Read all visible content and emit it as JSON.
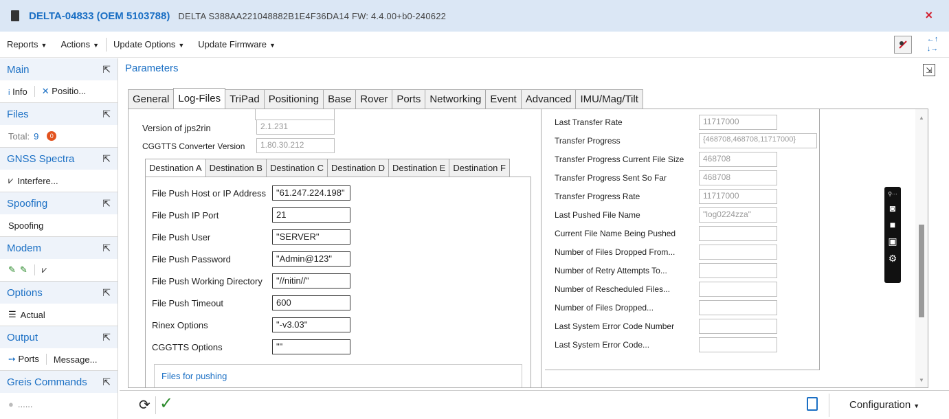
{
  "window": {
    "title": "DELTA-04833 (OEM 5103788)",
    "subtitle": "DELTA   S388AA221048882B1E4F36DA14   FW: 4.4.00+b0-240622",
    "close": "×"
  },
  "toolbar": {
    "reports": "Reports",
    "actions": "Actions",
    "update_options": "Update Options",
    "update_firmware": "Update Firmware",
    "caret": "▼"
  },
  "sidebar": {
    "main": {
      "label": "Main",
      "items": [
        "Info",
        "Positio..."
      ]
    },
    "files": {
      "label": "Files",
      "total_label": "Total:",
      "total": "9",
      "badge": "0"
    },
    "gnss": {
      "label": "GNSS Spectra",
      "item": "Interfere..."
    },
    "spoofing": {
      "label": "Spoofing",
      "item": "Spoofing"
    },
    "modem": {
      "label": "Modem"
    },
    "options": {
      "label": "Options",
      "item": "Actual"
    },
    "output": {
      "label": "Output",
      "items": [
        "Ports",
        "Message..."
      ]
    },
    "greis": {
      "label": "Greis Commands",
      "item": "......"
    }
  },
  "main": {
    "title": "Parameters",
    "tabs": [
      "General",
      "Log-Files",
      "TriPad",
      "Positioning",
      "Base",
      "Rover",
      "Ports",
      "Networking",
      "Event",
      "Advanced",
      "IMU/Mag/Tilt"
    ],
    "active_tab": "Log-Files"
  },
  "left": {
    "jps2rin_label": "Version of jps2rin",
    "jps2rin_value": "2.1.231",
    "cggtts_label": "CGGTTS Converter Version",
    "cggtts_value": "1.80.30.212",
    "dest_tabs": [
      "Destination A",
      "Destination B",
      "Destination C",
      "Destination D",
      "Destination E",
      "Destination F"
    ],
    "fields": [
      {
        "label": "File Push Host or IP Address",
        "value": "\"61.247.224.198\""
      },
      {
        "label": "File Push IP Port",
        "value": "21"
      },
      {
        "label": "File Push User",
        "value": "\"SERVER\""
      },
      {
        "label": "File Push Password",
        "value": "\"Admin@123\""
      },
      {
        "label": "File Push Working Directory",
        "value": "\"//nitin//\""
      },
      {
        "label": "File Push Timeout",
        "value": "600"
      },
      {
        "label": "Rinex Options",
        "value": "\"-v3.03\""
      },
      {
        "label": "CGGTTS Options",
        "value": "\"\""
      }
    ],
    "files_for_pushing": "Files for pushing"
  },
  "right": {
    "rows": [
      {
        "label": "Last Transfer Rate",
        "value": "11717000"
      },
      {
        "label": "Transfer Progress",
        "value": "{468708,468708,11717000}"
      },
      {
        "label": "Transfer Progress Current File Size",
        "value": "468708"
      },
      {
        "label": "Transfer Progress Sent So Far",
        "value": "468708"
      },
      {
        "label": "Transfer Progress Rate",
        "value": "11717000"
      },
      {
        "label": "Last Pushed File Name",
        "value": "\"log0224zza\""
      },
      {
        "label": "Current File Name Being Pushed",
        "value": ""
      },
      {
        "label": "Number of Files Dropped From...",
        "value": ""
      },
      {
        "label": "Number of Retry Attempts To...",
        "value": ""
      },
      {
        "label": "Number of Rescheduled Files...",
        "value": ""
      },
      {
        "label": "Number of Files Dropped...",
        "value": ""
      },
      {
        "label": "Last System Error Code Number",
        "value": ""
      },
      {
        "label": "Last System Error Code...",
        "value": ""
      }
    ]
  },
  "bottom": {
    "configuration": "Configuration"
  },
  "icons": {
    "refresh": "refresh-icon",
    "apply": "checkmark-icon",
    "device": "device-icon",
    "pin": "unpin-icon",
    "popout": "popout-icon"
  }
}
